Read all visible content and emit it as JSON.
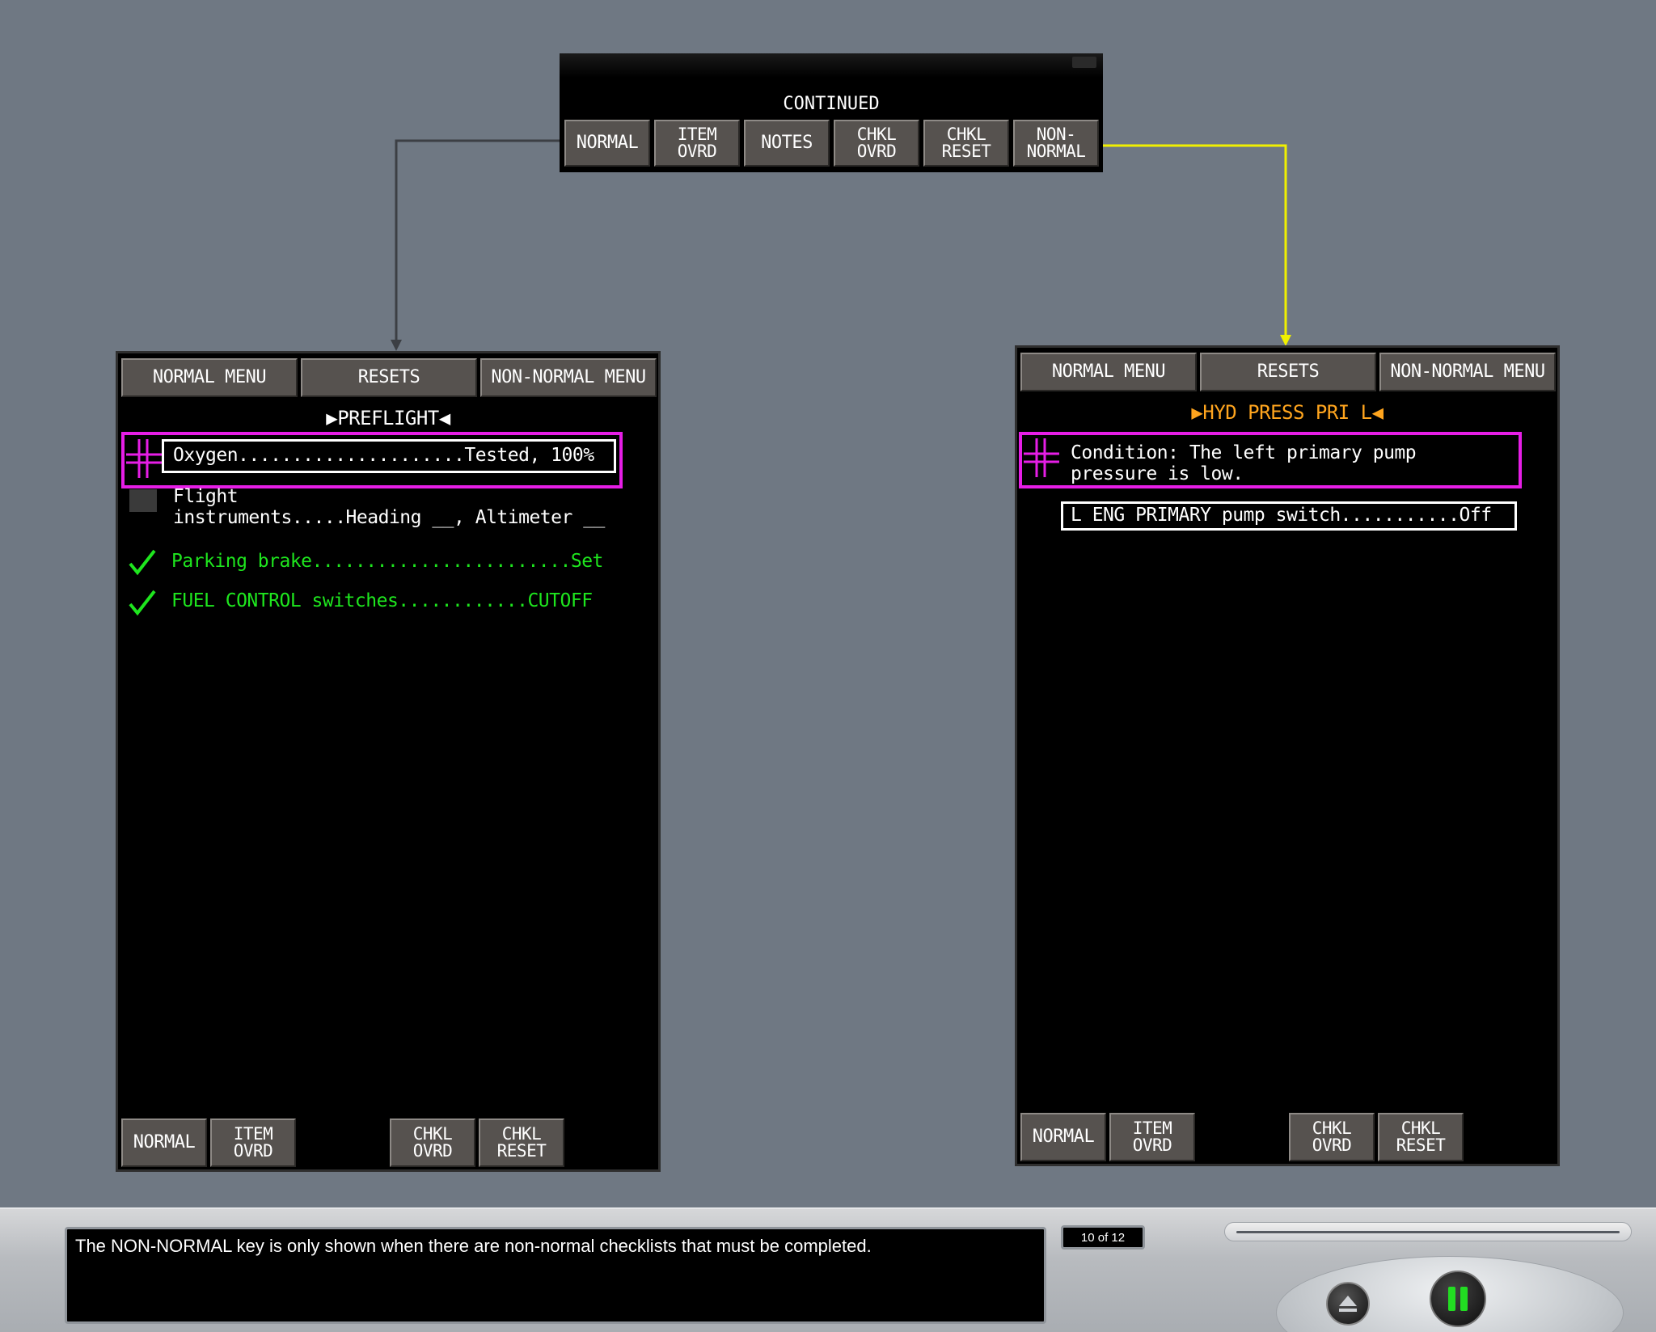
{
  "top_strip": {
    "label": "CONTINUED",
    "keys": [
      "NORMAL",
      "ITEM\nOVRD",
      "NOTES",
      "CHKL\nOVRD",
      "CHKL\nRESET",
      "NON-\nNORMAL"
    ]
  },
  "left_display": {
    "header_keys": [
      "NORMAL MENU",
      "RESETS",
      "NON-NORMAL MENU"
    ],
    "title": "▶PREFLIGHT◀",
    "items": [
      {
        "text": "Oxygen.....................Tested, 100%"
      },
      {
        "text": "Flight\ninstruments.....Heading __, Altimeter __"
      },
      {
        "text": "Parking brake........................Set"
      },
      {
        "text": "FUEL CONTROL switches............CUTOFF"
      }
    ],
    "footer_keys": [
      "NORMAL",
      "ITEM\nOVRD",
      "CHKL\nOVRD",
      "CHKL\nRESET"
    ]
  },
  "right_display": {
    "header_keys": [
      "NORMAL MENU",
      "RESETS",
      "NON-NORMAL MENU"
    ],
    "title": "▶HYD PRESS PRI L◀",
    "condition": "Condition: The left primary pump\npressure is low.",
    "step": "L ENG PRIMARY pump switch...........Off",
    "footer_keys": [
      "NORMAL",
      "ITEM\nOVRD",
      "CHKL\nOVRD",
      "CHKL\nRESET"
    ]
  },
  "control_bar": {
    "caption": "The NON-NORMAL key is only shown when there are non-normal checklists that must be completed.",
    "page_counter": "10 of 12"
  },
  "colors": {
    "background": "#6f7883",
    "key_face": "#56524f",
    "highlight": "#e61ee6",
    "completed": "#1ee61e",
    "title_amber": "#ffa51e",
    "connector_yellow": "#f0f000",
    "connector_dark": "#3c3f44"
  },
  "icons": [
    "cursor-cross-icon",
    "check-icon",
    "eject-icon",
    "pause-icon"
  ]
}
